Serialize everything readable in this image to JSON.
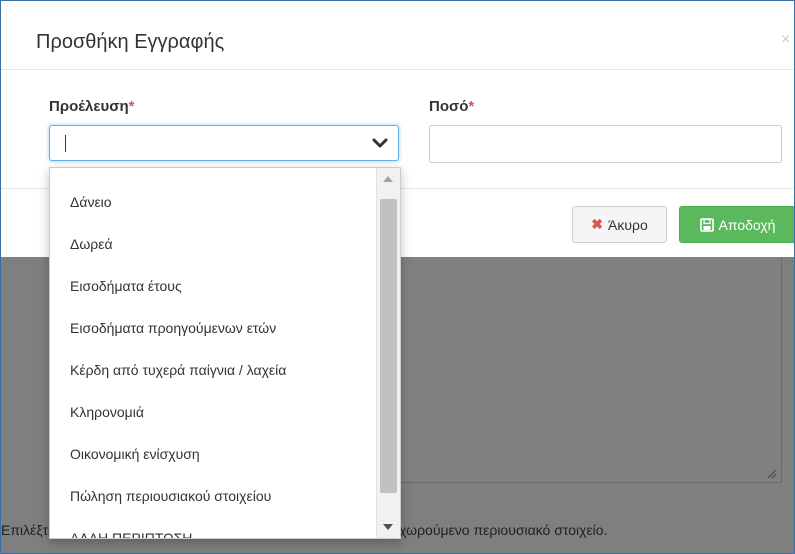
{
  "modal": {
    "title": "Προσθήκη Εγγραφής",
    "close": "×"
  },
  "form": {
    "origin_label": "Προέλευση",
    "amount_label": "Ποσό",
    "required_mark": "*",
    "origin_value": "",
    "amount_value": ""
  },
  "buttons": {
    "cancel_label": "Άκυρο",
    "accept_label": "Αποδοχή"
  },
  "dropdown": {
    "options": [
      "Δάνειο",
      "Δωρεά",
      "Εισοδήματα έτους",
      "Εισοδήματα προηγούμενων ετών",
      "Κέρδη από τυχερά παίγνια / λαχεία",
      "Κληρονομιά",
      "Οικονομική ενίσχυση",
      "Πώληση περιουσιακού στοιχείου",
      "ΑΛΛΗ ΠΕΡΙΠΤΩΣΗ"
    ]
  },
  "help_text": "Επιλέξτε με ποιο τρόπο ή από ποια πηγή έχει αποκτηθεί το καταχωρούμενο περιουσιακό στοιχείο.",
  "colors": {
    "accent": "#66afe9",
    "danger": "#d9534f",
    "success": "#5cb85c",
    "backdrop": "#7f7f7f"
  },
  "icons": {
    "chevron": "chevron-down-icon",
    "cancel": "x-mark-icon",
    "save": "floppy-disk-icon"
  }
}
